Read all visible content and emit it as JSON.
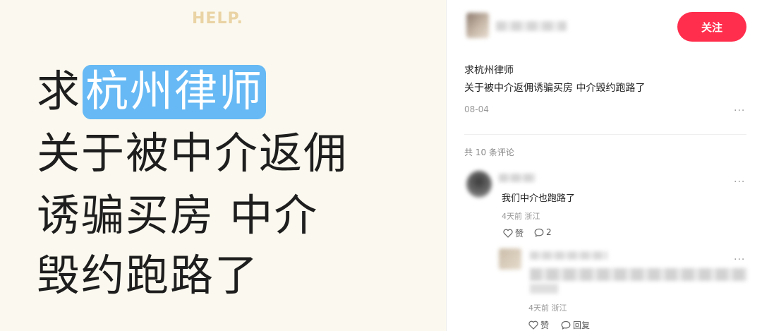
{
  "image": {
    "help_label": "HELP.",
    "line1_prefix": "求",
    "line1_highlight": "杭州律师",
    "line2": "关于被中介返佣",
    "line3": "诱骗买房 中介",
    "line4": "毁约跑路了",
    "highlight_color": "#66b9f4",
    "background_color": "#fbf9ef"
  },
  "post": {
    "follow_label": "关注",
    "title": "求杭州律师",
    "body": "关于被中介返佣诱骗买房 中介毁约跑路了",
    "date": "08-04",
    "more": "···",
    "accent_color": "#ff2e4d"
  },
  "comments": {
    "count_label": "共 10 条评论",
    "items": [
      {
        "text": "我们中介也跑路了",
        "time": "4天前",
        "location": "浙江",
        "like_label": "赞",
        "reply_count": "2"
      },
      {
        "time": "4天前",
        "location": "浙江",
        "like_label": "赞",
        "reply_label": "回复"
      }
    ]
  },
  "icons": {
    "more": "more-dots-icon",
    "like": "heart-icon",
    "comment": "comment-bubble-icon"
  }
}
